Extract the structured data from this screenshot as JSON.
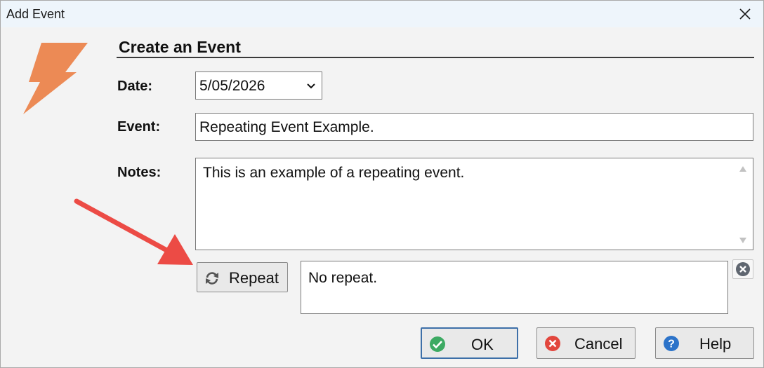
{
  "window": {
    "title": "Add Event"
  },
  "header": {
    "section_title": "Create an Event"
  },
  "form": {
    "date_label": "Date:",
    "date_value": "5/05/2026",
    "event_label": "Event:",
    "event_value": "Repeating Event Example.",
    "notes_label": "Notes:",
    "notes_value": "This is an example of a repeating event."
  },
  "repeat": {
    "button_label": "Repeat",
    "summary": "No repeat."
  },
  "buttons": {
    "ok": "OK",
    "cancel": "Cancel",
    "help": "Help"
  },
  "icons": {
    "logo": "lightning-bolt-icon",
    "repeat": "refresh-icon",
    "clear": "clear-x-icon",
    "ok": "check-circle-icon",
    "cancel": "cancel-circle-icon",
    "help": "help-circle-icon"
  },
  "colors": {
    "accent_orange": "#ec8a55",
    "arrow_red": "#ec4b45",
    "ok_green": "#3daa63",
    "cancel_red": "#e2463d",
    "help_blue": "#2c73c9"
  }
}
